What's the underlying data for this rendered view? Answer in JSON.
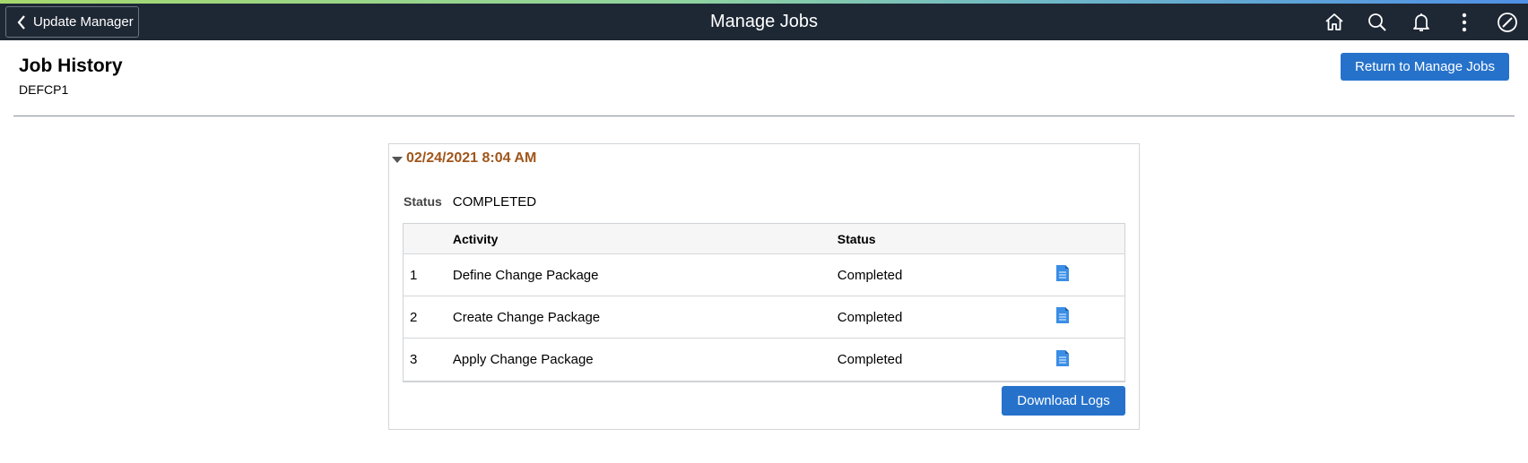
{
  "header": {
    "back_label": "Update Manager",
    "title": "Manage Jobs",
    "icons": [
      "home-icon",
      "search-icon",
      "bell-icon",
      "more-vertical-icon",
      "compass-icon"
    ]
  },
  "page": {
    "title": "Job History",
    "subtitle": "DEFCP1",
    "return_button": "Return to Manage Jobs"
  },
  "job": {
    "datetime": "02/24/2021 8:04 AM",
    "status_label": "Status",
    "status_value": "COMPLETED",
    "table": {
      "columns": [
        "",
        "Activity",
        "Status",
        ""
      ],
      "rows": [
        {
          "num": "1",
          "activity": "Define Change Package",
          "status": "Completed",
          "log_icon": "document-icon"
        },
        {
          "num": "2",
          "activity": "Create Change Package",
          "status": "Completed",
          "log_icon": "document-icon"
        },
        {
          "num": "3",
          "activity": "Apply Change Package",
          "status": "Completed",
          "log_icon": "document-icon"
        }
      ]
    },
    "download_button": "Download Logs"
  },
  "colors": {
    "header_bg": "#1e2734",
    "primary_button": "#2672cb",
    "date_text": "#a0561b",
    "doc_icon": "#3a8ee6"
  }
}
